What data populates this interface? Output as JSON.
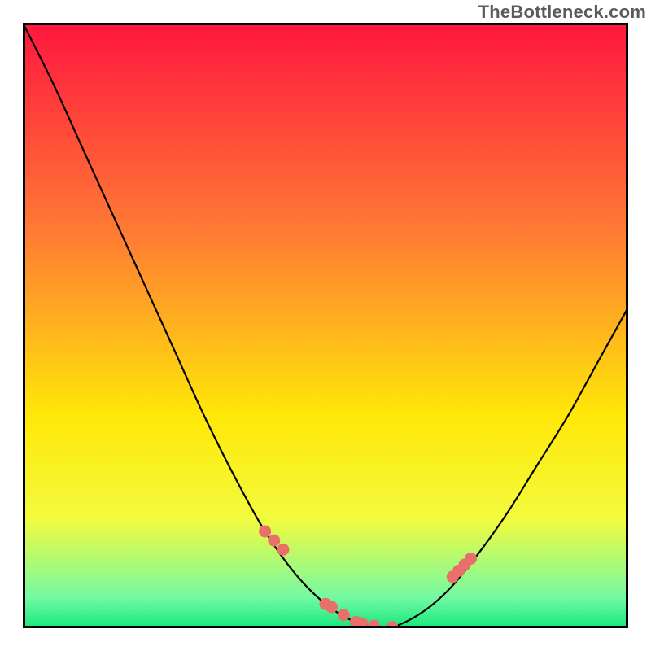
{
  "attribution": "TheBottleneck.com",
  "chart_data": {
    "type": "line",
    "title": "",
    "xlabel": "",
    "ylabel": "",
    "xlim": [
      0,
      100
    ],
    "ylim": [
      0,
      100
    ],
    "grid": false,
    "legend": false,
    "series": [
      {
        "name": "bottleneck-curve",
        "x": [
          0,
          5,
          10,
          15,
          20,
          25,
          30,
          35,
          40,
          45,
          50,
          55,
          60,
          65,
          70,
          75,
          80,
          85,
          90,
          95,
          100
        ],
        "values": [
          100,
          90,
          79,
          68,
          57,
          46,
          35,
          25,
          16,
          9,
          4,
          1,
          0,
          2,
          6,
          12,
          19,
          27,
          35,
          44,
          53
        ]
      }
    ],
    "markers": {
      "name": "highlight-points",
      "color": "#e96f6b",
      "x": [
        40,
        41.5,
        43,
        50,
        51,
        53,
        55,
        56,
        58,
        61,
        71,
        72,
        73,
        74
      ],
      "values": [
        16,
        14.5,
        13,
        4,
        3.5,
        2.2,
        1,
        0.8,
        0.4,
        0.2,
        8.5,
        9.5,
        10.5,
        11.5
      ]
    },
    "background_gradient": {
      "stops": [
        {
          "offset": 0,
          "color": "#ff163f"
        },
        {
          "offset": 35,
          "color": "#ff7c34"
        },
        {
          "offset": 65,
          "color": "#ffe808"
        },
        {
          "offset": 82,
          "color": "#f3fb3e"
        },
        {
          "offset": 95,
          "color": "#73f9a3"
        },
        {
          "offset": 100,
          "color": "#16e77c"
        }
      ]
    }
  }
}
